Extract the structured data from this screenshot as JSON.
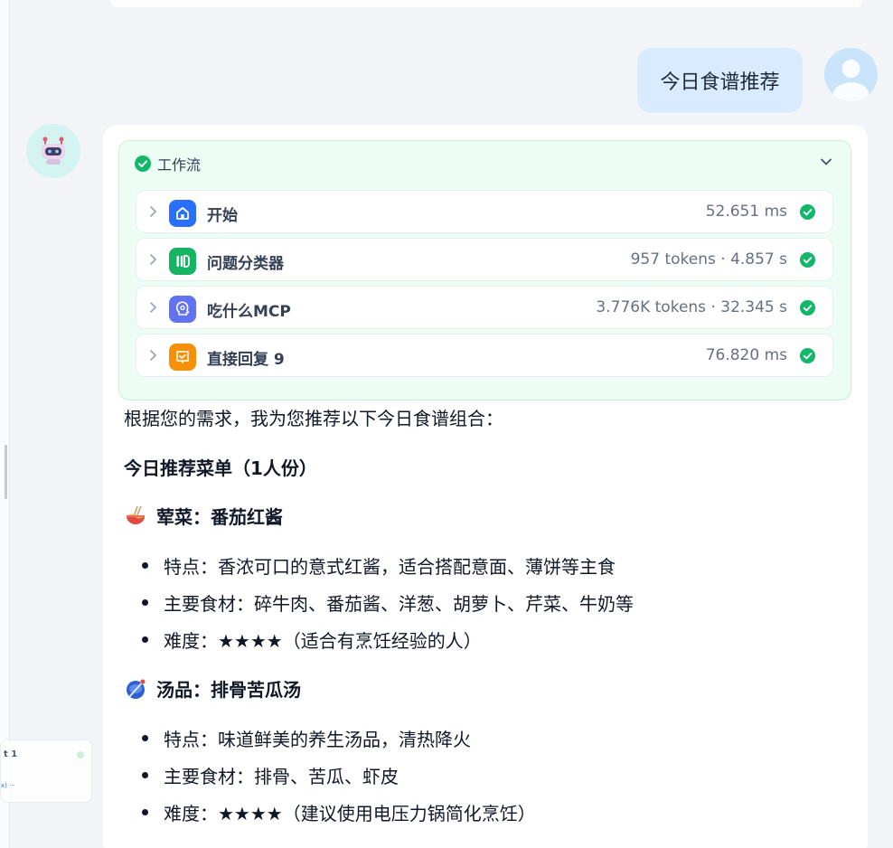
{
  "sidebar_preview": {
    "title_fragment": "t 1",
    "sub_fragment": "x) ···"
  },
  "user_message": {
    "text": "今日食谱推荐"
  },
  "workflow": {
    "title": "工作流",
    "status_color": "#12b76a",
    "steps": [
      {
        "name": "开始",
        "meta": "52.651 ms",
        "icon": "home-icon",
        "color": "#2970ff"
      },
      {
        "name": "问题分类器",
        "meta": "957 tokens · 4.857 s",
        "icon": "classifier-icon",
        "color": "#16b364"
      },
      {
        "name": "吃什么MCP",
        "meta": "3.776K tokens · 32.345 s",
        "icon": "brain-icon",
        "color": "#6172f3"
      },
      {
        "name": "直接回复 9",
        "meta": "76.820 ms",
        "icon": "reply-icon",
        "color": "#f79009"
      }
    ]
  },
  "answer": {
    "intro": "根据您的需求，我为您推荐以下今日食谱组合：",
    "menu_title": "今日推荐菜单（1人份）",
    "dishes": [
      {
        "title": "荤菜：番茄红酱",
        "icon": "noodles-emoji-icon",
        "bullets": [
          "特点：香浓可口的意式红酱，适合搭配意面、薄饼等主食",
          "主要食材：碎牛肉、番茄酱、洋葱、胡萝卜、芹菜、牛奶等",
          "难度：★★★★（适合有烹饪经验的人）"
        ]
      },
      {
        "title": "汤品：排骨苦瓜汤",
        "icon": "soup-emoji-icon",
        "bullets": [
          "特点：味道鲜美的养生汤品，清热降火",
          "主要食材：排骨、苦瓜、虾皮",
          "难度：★★★★（建议使用电压力锅简化烹饪）"
        ]
      }
    ]
  }
}
